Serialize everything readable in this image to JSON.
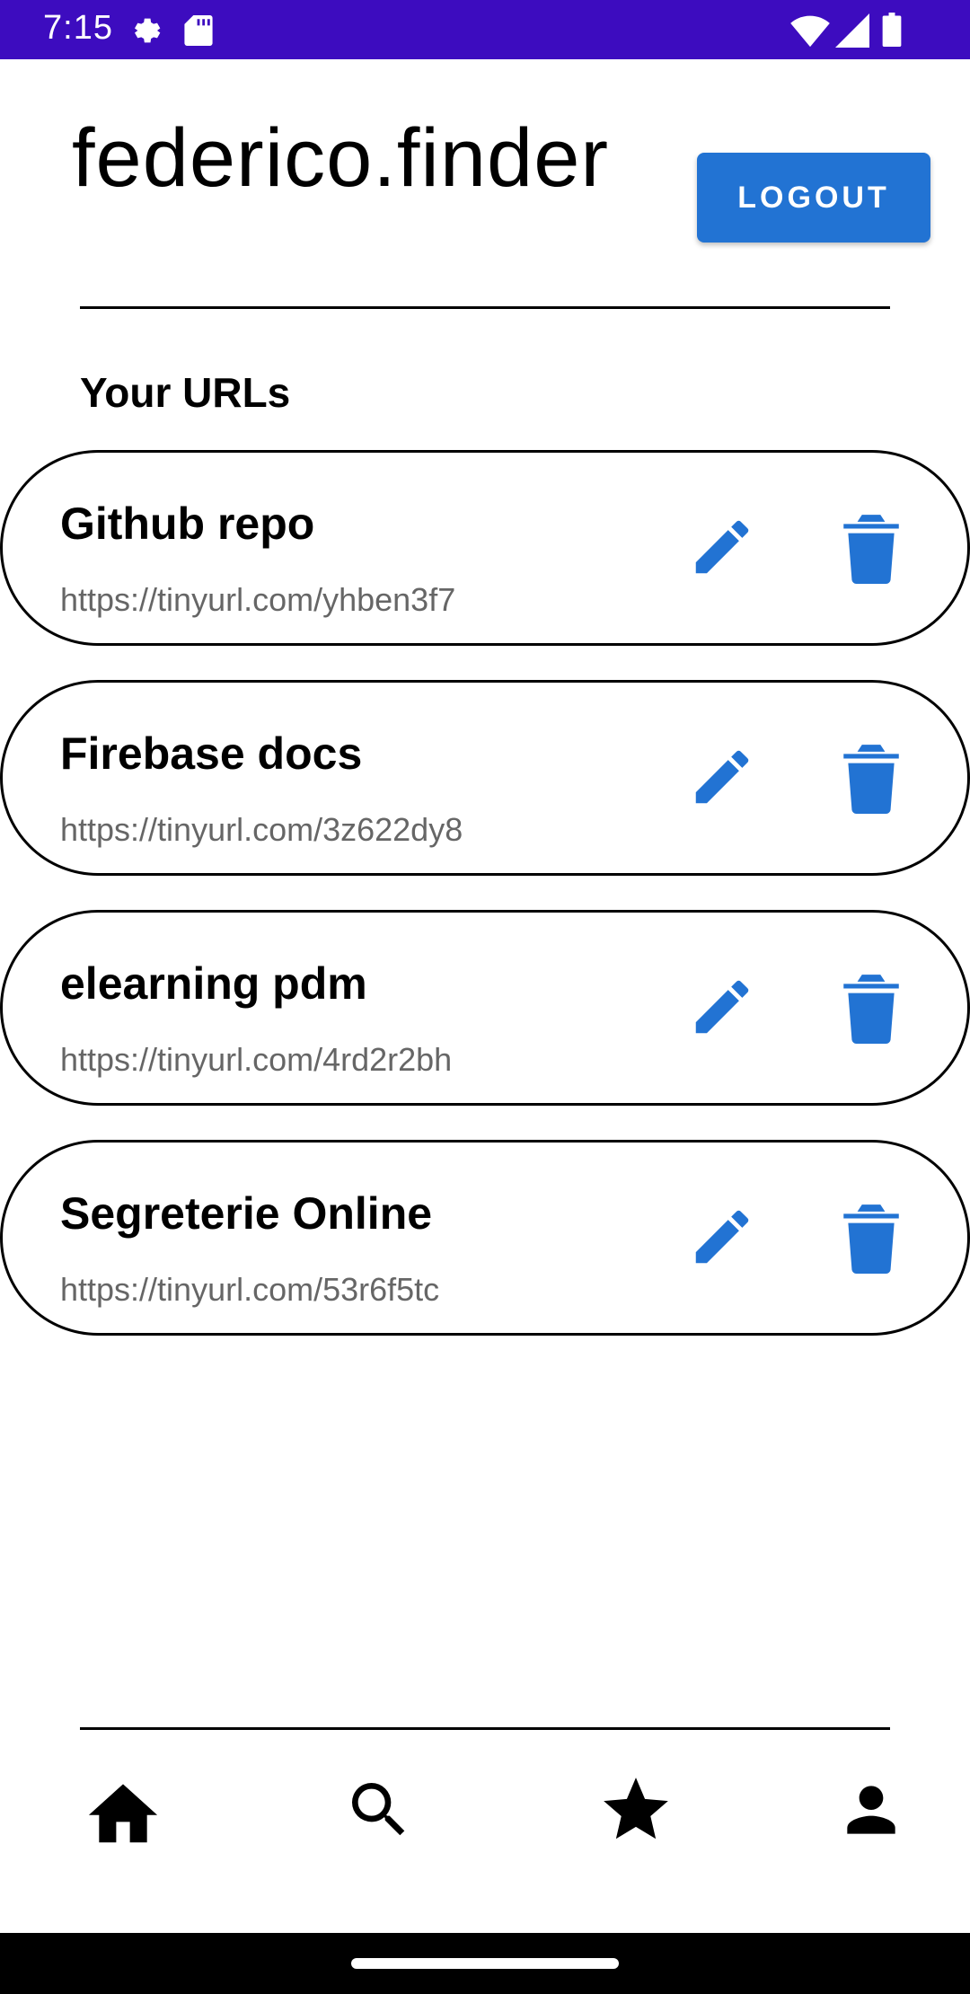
{
  "status_bar": {
    "time": "7:15",
    "icons": [
      "settings-gear-icon",
      "sd-card-icon",
      "wifi-icon",
      "cellular-signal-icon",
      "battery-icon"
    ],
    "background": "#3d0cbf"
  },
  "header": {
    "username": "federico.finder",
    "logout_label": "LOGOUT"
  },
  "section": {
    "title": "Your URLs"
  },
  "urls": [
    {
      "name": "Github repo",
      "link": "https://tinyurl.com/yhben3f7"
    },
    {
      "name": "Firebase docs",
      "link": "https://tinyurl.com/3z622dy8"
    },
    {
      "name": "elearning pdm",
      "link": "https://tinyurl.com/4rd2r2bh"
    },
    {
      "name": "Segreterie Online",
      "link": "https://tinyurl.com/53r6f5tc"
    }
  ],
  "bottom_nav": {
    "items": [
      "home-icon",
      "search-icon",
      "star-icon",
      "person-icon"
    ]
  },
  "colors": {
    "accent": "#2273d3",
    "status_bar": "#3d0cbf",
    "link_text": "#666666"
  }
}
